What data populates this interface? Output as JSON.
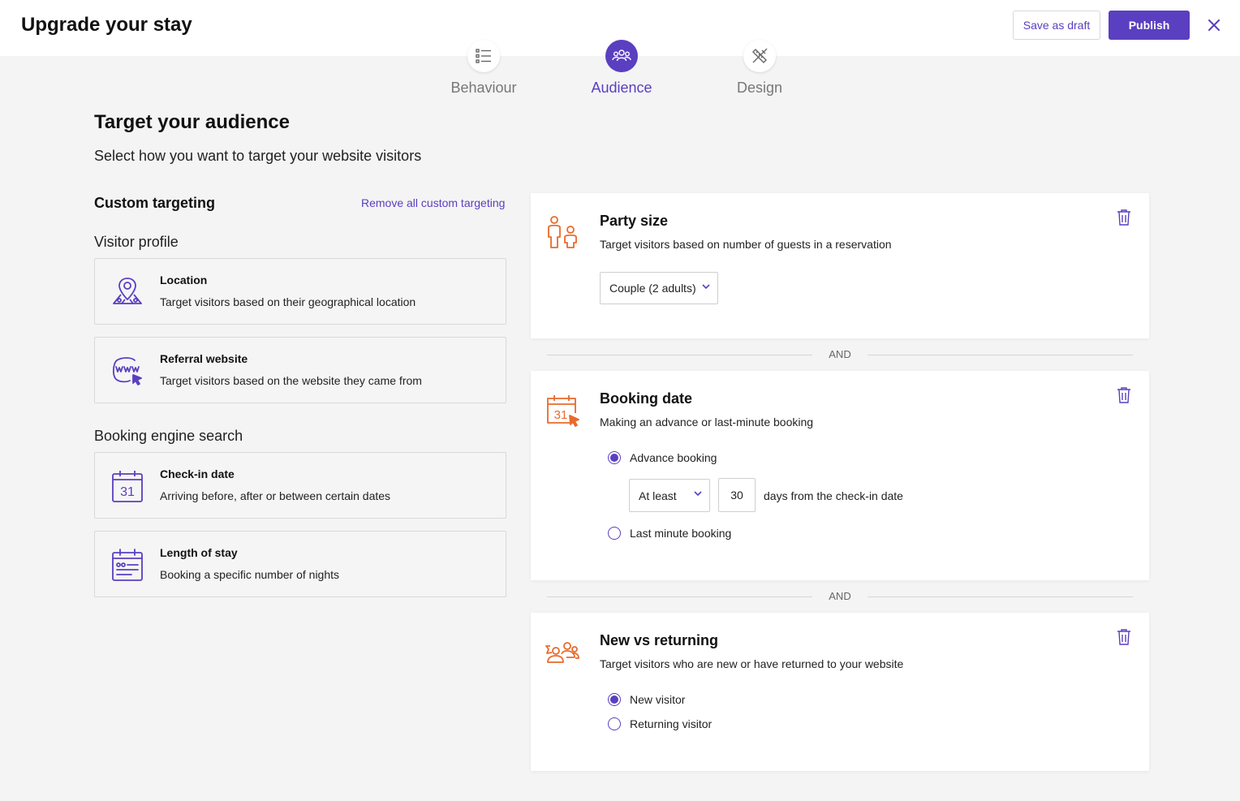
{
  "header": {
    "title": "Upgrade your stay",
    "save_draft_label": "Save as draft",
    "publish_label": "Publish"
  },
  "steps": [
    {
      "label": "Behaviour",
      "icon": "list-icon",
      "active": false
    },
    {
      "label": "Audience",
      "icon": "people-icon",
      "active": true
    },
    {
      "label": "Design",
      "icon": "design-tools-icon",
      "active": false
    }
  ],
  "main": {
    "heading": "Target your audience",
    "subheading": "Select how you want to target your website visitors"
  },
  "custom_targeting": {
    "title": "Custom targeting",
    "remove_all_label": "Remove all custom targeting",
    "groups": [
      {
        "title": "Visitor profile",
        "options": [
          {
            "title": "Location",
            "desc": "Target visitors based on their geographical location",
            "icon": "map-pin-icon"
          },
          {
            "title": "Referral website",
            "desc": "Target visitors based on the website they came from",
            "icon": "www-cursor-icon"
          }
        ]
      },
      {
        "title": "Booking engine search",
        "options": [
          {
            "title": "Check-in date",
            "desc": "Arriving before, after or between certain dates",
            "icon": "calendar-31-icon"
          },
          {
            "title": "Length of stay",
            "desc": "Booking a specific number of nights",
            "icon": "calendar-nights-icon"
          }
        ]
      }
    ]
  },
  "rules": {
    "connector": "AND",
    "party_size": {
      "title": "Party size",
      "desc": "Target visitors based on number of guests in a reservation",
      "selected": "Couple (2 adults)",
      "icon": "guests-icon"
    },
    "booking_date": {
      "title": "Booking date",
      "desc": "Making an advance or last-minute booking",
      "icon": "calendar-cursor-icon",
      "advance_label": "Advance booking",
      "qualifier": "At least",
      "days_value": "30",
      "days_suffix": "days from the check-in date",
      "last_minute_label": "Last minute booking",
      "selected": "advance"
    },
    "new_vs_returning": {
      "title": "New vs returning",
      "desc": "Target visitors who are new or have returned to your website",
      "icon": "visitors-icon",
      "new_label": "New visitor",
      "returning_label": "Returning visitor",
      "selected": "new"
    }
  },
  "colors": {
    "accent": "#5a3fc0",
    "orange_icon": "#e86a2c",
    "background": "#f4f4f4"
  }
}
